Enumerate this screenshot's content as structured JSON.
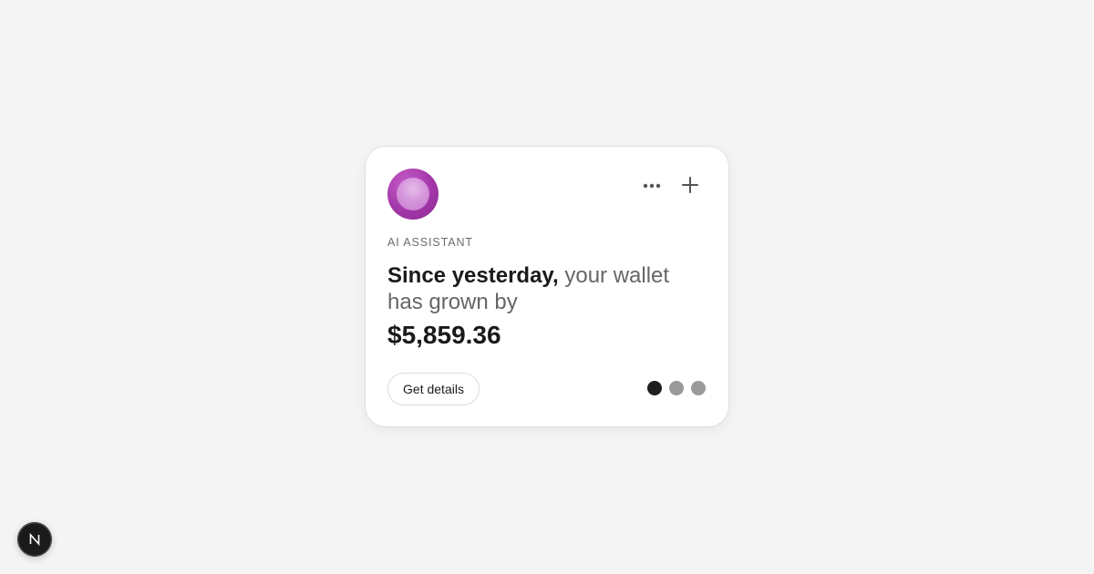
{
  "card": {
    "label": "AI ASSISTANT",
    "headline_strong": "Since yesterday,",
    "headline_rest": " your wallet has grown by",
    "amount": "$5,859.36",
    "details_button": "Get details",
    "more_icon": "more-horizontal-icon",
    "add_icon": "plus-icon",
    "pagination": {
      "total": 3,
      "active_index": 0
    }
  },
  "badge": {
    "icon": "nextjs-logo-icon"
  },
  "colors": {
    "background": "#f4f4f4",
    "card": "#ffffff",
    "orb_primary": "#a237a8",
    "orb_highlight": "#d79bde",
    "text_strong": "#1a1a1a",
    "text_muted": "#666666",
    "dot_active": "#1f1f1f",
    "dot_inactive": "#9a9a9a"
  }
}
